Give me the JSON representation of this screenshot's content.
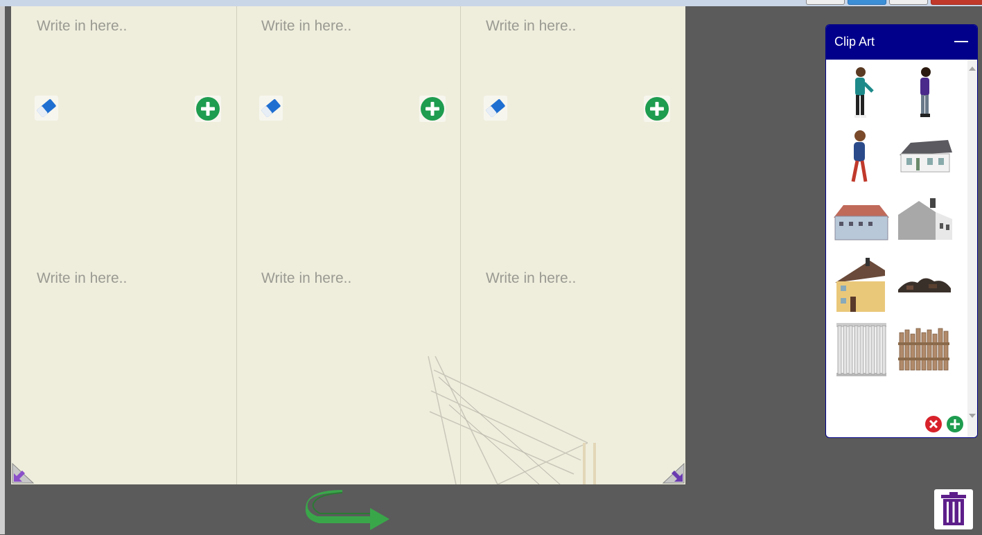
{
  "board": {
    "cells": [
      {
        "placeholder": "Write in here.."
      },
      {
        "placeholder": "Write in here.."
      },
      {
        "placeholder": "Write in here.."
      },
      {
        "placeholder": "Write in here.."
      },
      {
        "placeholder": "Write in here.."
      },
      {
        "placeholder": "Write in here.."
      }
    ]
  },
  "clipart": {
    "title": "Clip Art",
    "items": [
      "boy-pointing",
      "girl-walking",
      "boy-walking",
      "white-house",
      "blue-house",
      "grey-house",
      "yellow-house",
      "rubble",
      "white-fence",
      "wooden-fence"
    ]
  },
  "colors": {
    "panel_header": "#00008a",
    "board_bg": "#efeedd",
    "add_green": "#1e9c4f",
    "remove_red": "#d8222b",
    "trash_purple": "#5d1e8a",
    "rotate_green": "#3aa64a"
  }
}
